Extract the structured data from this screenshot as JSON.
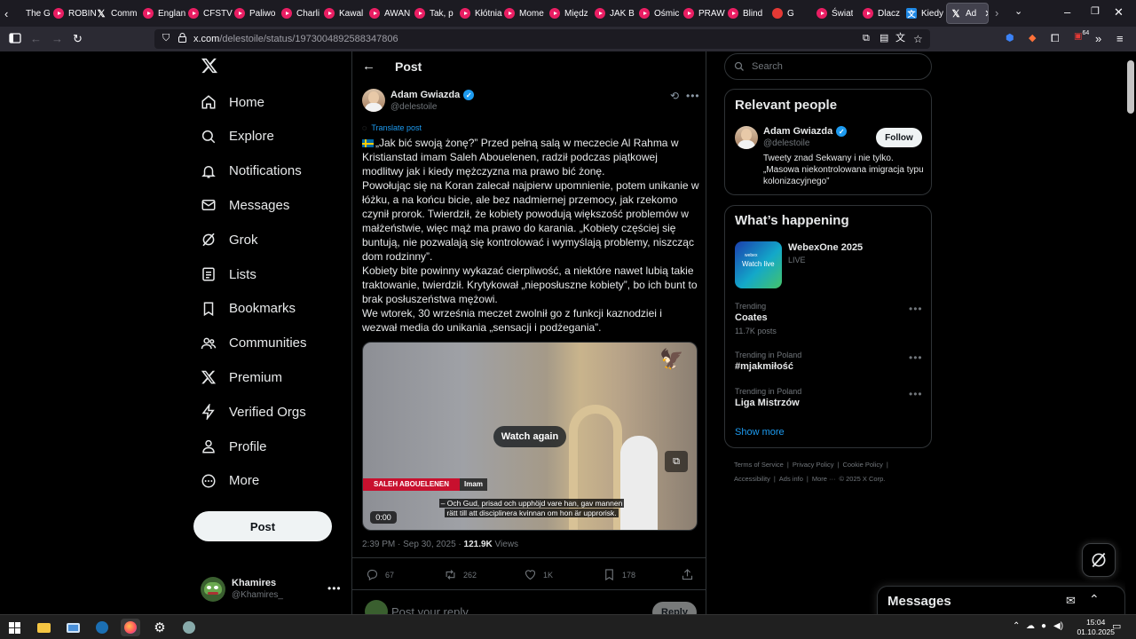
{
  "browser": {
    "tabs": [
      {
        "label": "The G",
        "icon": "firefox-tab-icon",
        "kind": "gen"
      },
      {
        "label": "ROBIN",
        "icon": "youtube-icon",
        "kind": "yt"
      },
      {
        "label": "Comm",
        "icon": "x-logo-icon",
        "kind": "x"
      },
      {
        "label": "Englan",
        "icon": "youtube-icon",
        "kind": "yt"
      },
      {
        "label": "CFSTV",
        "icon": "youtube-icon",
        "kind": "yt"
      },
      {
        "label": "Paliwo",
        "icon": "youtube-icon",
        "kind": "yt"
      },
      {
        "label": "Charli",
        "icon": "youtube-icon",
        "kind": "yt"
      },
      {
        "label": "Kawal",
        "icon": "youtube-icon",
        "kind": "yt"
      },
      {
        "label": "AWAN",
        "icon": "youtube-icon",
        "kind": "yt"
      },
      {
        "label": "Tak, p",
        "icon": "youtube-icon",
        "kind": "yt"
      },
      {
        "label": "Kłótnia",
        "icon": "youtube-icon",
        "kind": "yt"
      },
      {
        "label": "Mome",
        "icon": "youtube-icon",
        "kind": "yt"
      },
      {
        "label": "Międz",
        "icon": "youtube-icon",
        "kind": "yt"
      },
      {
        "label": "JAK B",
        "icon": "youtube-icon",
        "kind": "yt"
      },
      {
        "label": "Ośmic",
        "icon": "youtube-icon",
        "kind": "yt"
      },
      {
        "label": "PRAW",
        "icon": "youtube-icon",
        "kind": "yt"
      },
      {
        "label": "Blind",
        "icon": "youtube-icon",
        "kind": "yt"
      },
      {
        "label": "G",
        "icon": "youtube-icon",
        "kind": "gr"
      },
      {
        "label": "Świat",
        "icon": "youtube-icon",
        "kind": "yt"
      },
      {
        "label": "Dlacz",
        "icon": "youtube-icon",
        "kind": "yt"
      },
      {
        "label": "Kiedy",
        "icon": "translate-icon",
        "kind": "tr"
      },
      {
        "label": "Ad",
        "icon": "x-logo-icon",
        "kind": "x",
        "active": true
      }
    ],
    "url_host": "x.com",
    "url_path": "/delestoile/status/1973004892588347806",
    "extension_badge": "64"
  },
  "nav": {
    "items": [
      {
        "label": "Home",
        "icon": "home-icon"
      },
      {
        "label": "Explore",
        "icon": "search-icon"
      },
      {
        "label": "Notifications",
        "icon": "bell-icon"
      },
      {
        "label": "Messages",
        "icon": "envelope-icon"
      },
      {
        "label": "Grok",
        "icon": "grok-icon"
      },
      {
        "label": "Lists",
        "icon": "list-icon"
      },
      {
        "label": "Bookmarks",
        "icon": "bookmark-icon"
      },
      {
        "label": "Communities",
        "icon": "people-icon"
      },
      {
        "label": "Premium",
        "icon": "x-logo-icon"
      },
      {
        "label": "Verified Orgs",
        "icon": "lightning-icon"
      },
      {
        "label": "Profile",
        "icon": "person-icon"
      },
      {
        "label": "More",
        "icon": "more-circle-icon"
      }
    ],
    "post_label": "Post",
    "account": {
      "name": "Khamires",
      "handle": "@Khamires_"
    }
  },
  "post": {
    "header_title": "Post",
    "author_name": "Adam Gwiazda",
    "author_handle": "@delestoile",
    "translate_label": "Translate post",
    "paragraphs": [
      "„Jak bić swoją żonę?” Przed pełną salą w meczecie Al Rahma w Kristianstad imam Saleh Abouelenen, radził podczas piątkowej modlitwy jak i kiedy mężczyzna ma prawo bić żonę.",
      "Powołując się na Koran zalecał najpierw upomnienie, potem unikanie w łóżku, a na końcu bicie, ale bez nadmiernej przemocy, jak rzekomo czynił prorok. Twierdził, że kobiety powodują większość problemów w małżeństwie, więc mąż ma prawo do karania. „Kobiety częściej się buntują, nie pozwalają się kontrolować i wymyślają problemy, niszcząc dom rodzinny”.",
      "Kobiety bite powinny wykazać cierpliwość, a niektóre nawet lubią takie traktowanie, twierdził. Krytykował „nieposłuszne kobiety”, bo ich bunt to brak posłuszeństwa mężowi.",
      "We wtorek, 30 września meczet zwolnił go z funkcji kaznodziei i wezwał media do unikania „sensacji i podżegania”."
    ],
    "video": {
      "watch_again": "Watch again",
      "lower_third_name": "SALEH ABOUELENEN",
      "lower_third_role": "Imam",
      "subtitle_line1": "– Och Gud, prisad och upphöjd vare han, gav mannen",
      "subtitle_line2": "rätt till att disciplinera kvinnan om hon är upprorisk.",
      "time": "0:00"
    },
    "meta_time": "2:39 PM · Sep 30, 2025 · ",
    "meta_views": "121.9K",
    "meta_views_label": " Views",
    "actions": {
      "replies": "67",
      "reposts": "262",
      "likes": "1K",
      "bookmarks": "178"
    },
    "reply_placeholder": "Post your reply",
    "reply_button": "Reply"
  },
  "sidebar": {
    "search_placeholder": "Search",
    "relevant": {
      "title": "Relevant people",
      "name": "Adam Gwiazda",
      "handle": "@delestoile",
      "follow": "Follow",
      "bio": "Tweety znad Sekwany i nie tylko. „Masowa niekontrolowana imigracja typu kolonizacyjnego”"
    },
    "happening": {
      "title": "What’s happening",
      "event_title": "WebexOne 2025",
      "event_status": "LIVE",
      "thumb_brand": "webex",
      "thumb_watch": "Watch live",
      "trends": [
        {
          "meta": "Trending",
          "name": "Coates",
          "posts": "11.7K posts"
        },
        {
          "meta": "Trending in Poland",
          "name": "#mjakmiłość",
          "posts": ""
        },
        {
          "meta": "Trending in Poland",
          "name": "Liga Mistrzów",
          "posts": ""
        }
      ],
      "show_more": "Show more"
    },
    "footer": [
      "Terms of Service",
      "Privacy Policy",
      "Cookie Policy",
      "Accessibility",
      "Ads info",
      "More ···",
      "© 2025 X Corp."
    ]
  },
  "messages_bar": {
    "title": "Messages"
  },
  "taskbar": {
    "time": "15:04",
    "date": "01.10.2025"
  },
  "colors": {
    "accent": "#1d9bf0",
    "background": "#000000",
    "border": "#2f3336",
    "muted": "#71767b"
  }
}
